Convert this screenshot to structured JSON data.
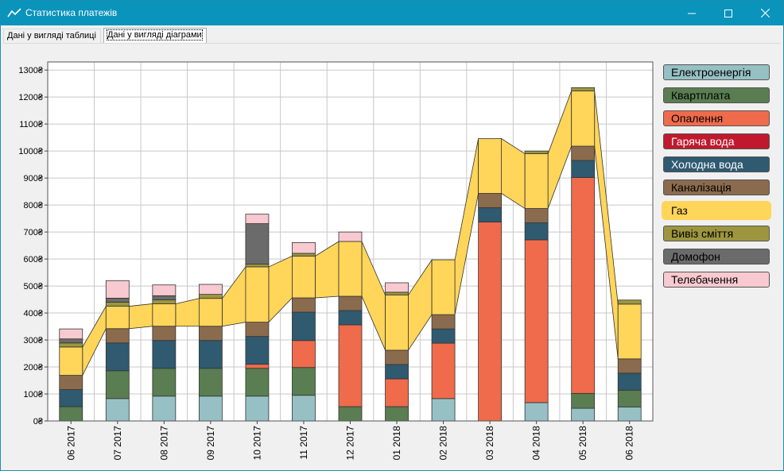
{
  "window": {
    "title": "Статистика платежів"
  },
  "tabs": [
    {
      "label": "Дані у вигляді таблиці",
      "active": false
    },
    {
      "label": "Дані у вигляді діаграми",
      "active": true
    }
  ],
  "chart_data": {
    "type": "bar",
    "stacked": true,
    "title": "",
    "xlabel": "",
    "ylabel": "",
    "ylim": [
      0,
      1330
    ],
    "yticks": [
      0,
      100,
      200,
      300,
      400,
      500,
      600,
      700,
      800,
      900,
      1000,
      1100,
      1200,
      1300
    ],
    "ytick_labels": [
      "0₴",
      "100₴",
      "200₴",
      "300₴",
      "400₴",
      "500₴",
      "600₴",
      "700₴",
      "800₴",
      "900₴",
      "1000₴",
      "1100₴",
      "1200₴",
      "1300₴"
    ],
    "grid": true,
    "legend_position": "right",
    "categories": [
      "06 2017",
      "07 2017",
      "08 2017",
      "09 2017",
      "10 2017",
      "11 2017",
      "12 2017",
      "01 2018",
      "02 2018",
      "03 2018",
      "04 2018",
      "05 2018",
      "06 2018"
    ],
    "series": [
      {
        "name": "Електроенергія",
        "color": "#96c0c4",
        "values": [
          0,
          83,
          92,
          92,
          92,
          95,
          0,
          0,
          83,
          0,
          68,
          47,
          52
        ]
      },
      {
        "name": "Квартплата",
        "color": "#5a7d52",
        "values": [
          53,
          103,
          103,
          103,
          103,
          103,
          53,
          53,
          0,
          0,
          0,
          55,
          62
        ]
      },
      {
        "name": "Опалення",
        "color": "#ef6b4b",
        "values": [
          0,
          0,
          0,
          0,
          15,
          100,
          303,
          103,
          205,
          737,
          603,
          800,
          0
        ]
      },
      {
        "name": "Гаряча вода",
        "color": "#c0192d",
        "values": [
          0,
          0,
          0,
          0,
          0,
          0,
          0,
          0,
          0,
          0,
          0,
          0,
          0
        ]
      },
      {
        "name": "Холодна вода",
        "color": "#2f5a70",
        "values": [
          63,
          103,
          103,
          103,
          103,
          105,
          53,
          53,
          53,
          53,
          63,
          63,
          63
        ]
      },
      {
        "name": "Каналізація",
        "color": "#8b6b4e",
        "values": [
          53,
          53,
          53,
          53,
          53,
          53,
          53,
          53,
          53,
          53,
          53,
          53,
          53
        ]
      },
      {
        "name": "Газ",
        "color": "#ffd55a",
        "values": [
          105,
          83,
          83,
          103,
          205,
          155,
          203,
          205,
          203,
          203,
          203,
          205,
          203
        ]
      },
      {
        "name": "Вивіз сміття",
        "color": "#9d963f",
        "values": [
          15,
          15,
          15,
          15,
          10,
          10,
          0,
          10,
          0,
          0,
          10,
          12,
          15
        ]
      },
      {
        "name": "Домофон",
        "color": "#6b6b6b",
        "values": [
          15,
          15,
          15,
          0,
          150,
          0,
          0,
          0,
          0,
          0,
          0,
          0,
          0
        ]
      },
      {
        "name": "Телебачення",
        "color": "#f8c9d0",
        "values": [
          37,
          65,
          40,
          37,
          35,
          40,
          35,
          35,
          0,
          0,
          0,
          0,
          0
        ]
      }
    ],
    "flow_series": "Газ"
  }
}
